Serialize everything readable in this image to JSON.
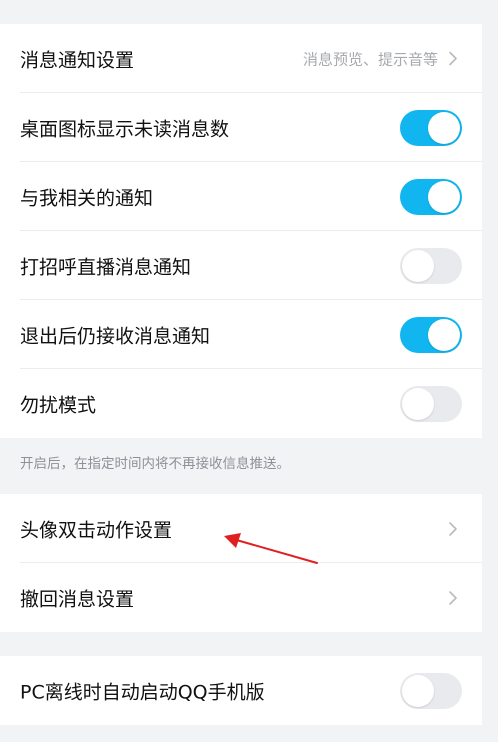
{
  "group1": {
    "rows": [
      {
        "label": "消息通知设置",
        "hint": "消息预览、提示音等"
      },
      {
        "label": "桌面图标显示未读消息数",
        "toggle": true
      },
      {
        "label": "与我相关的通知",
        "toggle": true
      },
      {
        "label": "打招呼直播消息通知",
        "toggle": false
      },
      {
        "label": "退出后仍接收消息通知",
        "toggle": true
      },
      {
        "label": "勿扰模式",
        "toggle": false
      }
    ],
    "caption": "开启后，在指定时间内将不再接收信息推送。"
  },
  "group2": {
    "rows": [
      {
        "label": "头像双击动作设置"
      },
      {
        "label": "撤回消息设置"
      }
    ]
  },
  "group3": {
    "rows": [
      {
        "label": "PC离线时自动启动QQ手机版",
        "toggle": false
      }
    ]
  },
  "colors": {
    "toggle_on": "#11b6f1",
    "toggle_off": "#e9eaed",
    "annotation_arrow": "#e02020"
  },
  "icons": {
    "chevron": "chevron-right-icon",
    "annotation": "red-arrow-annotation"
  }
}
